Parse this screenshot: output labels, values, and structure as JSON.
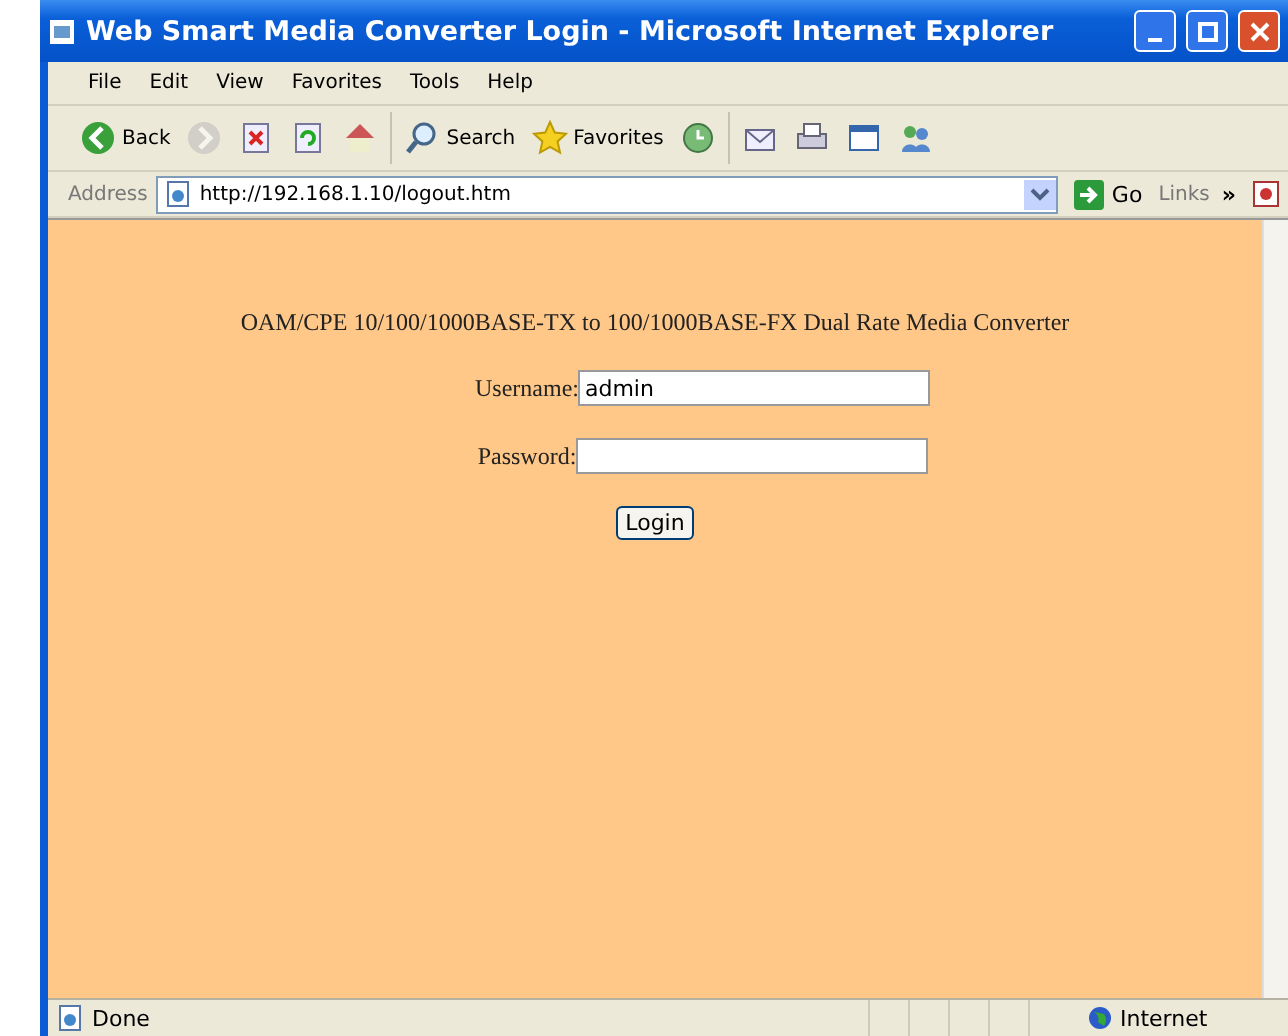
{
  "window": {
    "title": "Web Smart Media Converter Login - Microsoft Internet Explorer"
  },
  "menu": [
    "File",
    "Edit",
    "View",
    "Favorites",
    "Tools",
    "Help"
  ],
  "toolbar": [
    {
      "kind": "back",
      "label": "Back",
      "disabled": false
    },
    {
      "kind": "forward",
      "disabled": true
    },
    {
      "kind": "stop",
      "disabled": false
    },
    {
      "kind": "refresh",
      "disabled": false
    },
    {
      "kind": "home",
      "disabled": false
    },
    {
      "kind": "search",
      "label": "Search",
      "disabled": false
    },
    {
      "kind": "favorites",
      "label": "Favorites",
      "disabled": false
    },
    {
      "kind": "history",
      "disabled": false
    },
    {
      "kind": "mail",
      "disabled": false
    },
    {
      "kind": "print",
      "disabled": false
    },
    {
      "kind": "edit",
      "disabled": false
    },
    {
      "kind": "messenger",
      "disabled": false
    }
  ],
  "address": {
    "label": "Address",
    "url": "http://192.168.1.10/logout.htm",
    "go": "Go",
    "links": "Links",
    "chevron": "»"
  },
  "page": {
    "heading": "OAM/CPE 10/100/1000BASE-TX to 100/1000BASE-FX Dual Rate Media Converter",
    "fields": [
      {
        "kind": "text",
        "label": "Username:",
        "value": "admin"
      },
      {
        "kind": "password",
        "label": "Password:"
      }
    ],
    "button": "Login"
  },
  "status_bar": {
    "text": "Done",
    "zone": "Internet"
  }
}
